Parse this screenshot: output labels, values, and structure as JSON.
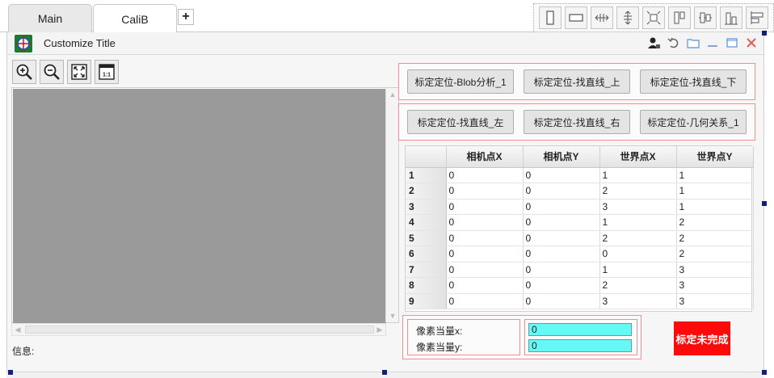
{
  "tabs": [
    {
      "label": "Main",
      "active": false
    },
    {
      "label": "CaliB",
      "active": true
    }
  ],
  "add_tab_label": "+",
  "window": {
    "title": "Customize Title",
    "logo_icon": "crosshair-logo-icon"
  },
  "layout_tools": [
    "layout-vertical-icon",
    "layout-horizontal-icon",
    "resize-horizontal-icon",
    "resize-vertical-icon",
    "move-all-icon",
    "align-left-bars-icon",
    "align-center-bars-icon",
    "align-bottom-bars-icon",
    "align-left-edge-icon"
  ],
  "window_controls": [
    "user-lock-icon",
    "undo-icon",
    "folder-open-icon",
    "minimize-icon",
    "restore-icon",
    "close-icon"
  ],
  "viewer_tools": [
    "zoom-in-icon",
    "zoom-out-icon",
    "fit-screen-icon",
    "actual-size-icon"
  ],
  "viewer_actual_size_text": "1:1",
  "info_label": "信息:",
  "calibration_buttons": [
    "标定定位-Blob分析_1",
    "标定定位-找直线_上",
    "标定定位-找直线_下",
    "标定定位-找直线_左",
    "标定定位-找直线_右",
    "标定定位-几何关系_1"
  ],
  "grid": {
    "columns": [
      "",
      "相机点X",
      "相机点Y",
      "世界点X",
      "世界点Y"
    ],
    "rows": [
      [
        "1",
        "0",
        "0",
        "1",
        "1"
      ],
      [
        "2",
        "0",
        "0",
        "2",
        "1"
      ],
      [
        "3",
        "0",
        "0",
        "3",
        "1"
      ],
      [
        "4",
        "0",
        "0",
        "1",
        "2"
      ],
      [
        "5",
        "0",
        "0",
        "2",
        "2"
      ],
      [
        "6",
        "0",
        "0",
        "0",
        "2"
      ],
      [
        "7",
        "0",
        "0",
        "1",
        "3"
      ],
      [
        "8",
        "0",
        "0",
        "2",
        "3"
      ],
      [
        "9",
        "0",
        "0",
        "3",
        "3"
      ]
    ]
  },
  "pixel_scale": {
    "x_label": "像素当量x:",
    "y_label": "像素当量y:",
    "x_value": "0",
    "y_value": "0"
  },
  "status_button": "标定未完成",
  "colors": {
    "status_bg": "#ff0a0a",
    "input_bg": "#66f7f7",
    "group_border": "#ef8f8f",
    "viewer_bg": "#9a9a9a"
  }
}
